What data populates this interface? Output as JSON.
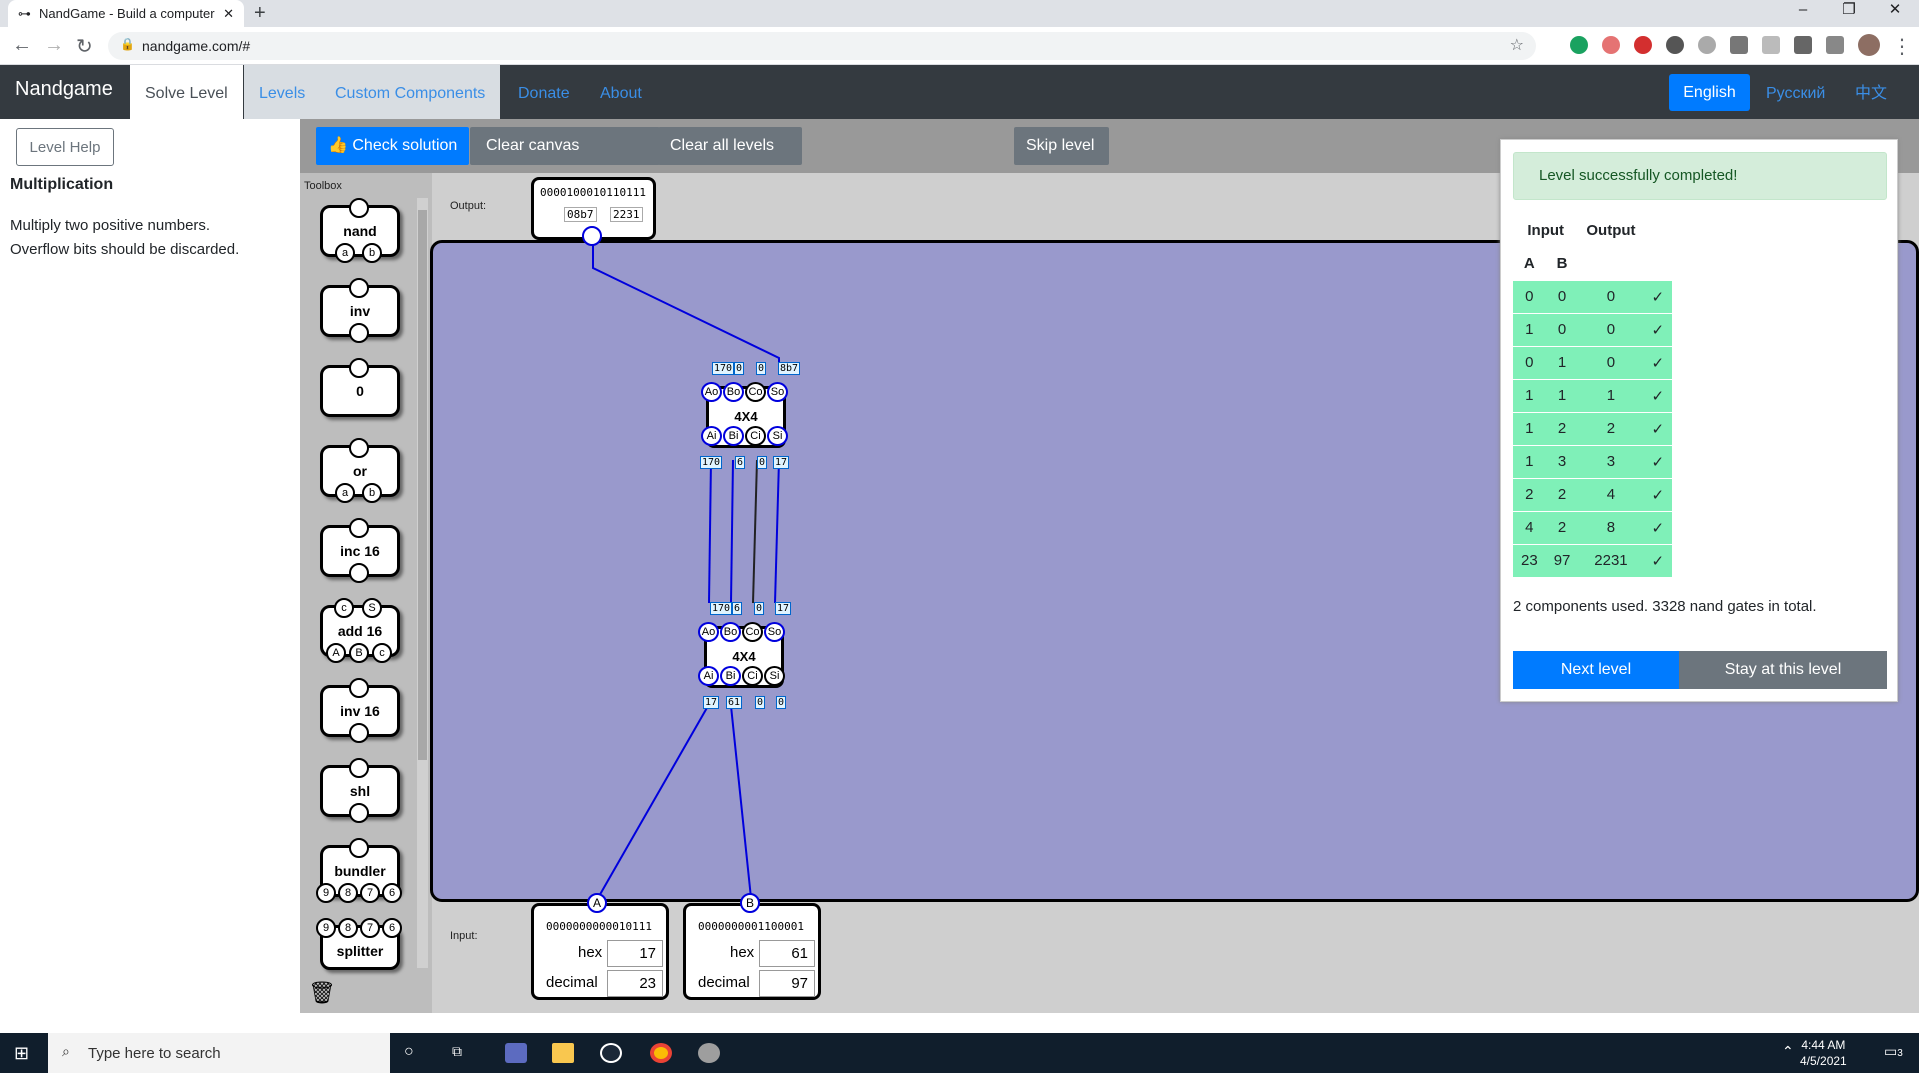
{
  "browser": {
    "tab_title": "NandGame - Build a computer fr",
    "url": "nandgame.com/#"
  },
  "nav": {
    "brand": "Nandgame",
    "links": [
      "Solve Level",
      "Levels",
      "Custom Components",
      "Donate",
      "About"
    ],
    "languages": [
      "English",
      "Русский",
      "中文"
    ]
  },
  "level": {
    "help_button": "Level Help",
    "title": "Multiplication",
    "description_line1": "Multiply two positive numbers.",
    "description_line2": "Overflow bits should be discarded."
  },
  "toolbar": {
    "check": "Check solution",
    "clear_canvas": "Clear canvas",
    "clear_all": "Clear all levels",
    "skip": "Skip level"
  },
  "toolbox": {
    "label": "Toolbox",
    "items": [
      "nand",
      "inv",
      "0",
      "or",
      "inc 16",
      "add 16",
      "inv 16",
      "shl",
      "bundler",
      "splitter"
    ]
  },
  "canvas": {
    "output_label": "Output:",
    "input_label": "Input:",
    "output_bits": "0000100010110111",
    "output_hex": "08b7",
    "output_dec": "2231",
    "input_a_bits": "0000000000010111",
    "input_a_hex": "17",
    "input_a_dec": "23",
    "input_b_bits": "0000000001100001",
    "input_b_hex": "61",
    "input_b_dec": "97",
    "hex_label": "hex",
    "decimal_label": "decimal",
    "pin_a": "A",
    "pin_b": "B",
    "comp_name": "4X4",
    "top_comp": {
      "ao": "170",
      "bo": "0",
      "co": "0",
      "so": "8b7",
      "ai": "170",
      "bi": "6",
      "ci": "0",
      "si": "17"
    },
    "bottom_comp": {
      "ao": "170",
      "bo": "6",
      "co": "0",
      "so": "17",
      "ai": "17",
      "bi": "61",
      "ci": "0",
      "si": "0"
    }
  },
  "result": {
    "message": "Level successfully completed!",
    "header_input": "Input",
    "header_output": "Output",
    "col_a": "A",
    "col_b": "B",
    "rows": [
      [
        "0",
        "0",
        "0"
      ],
      [
        "1",
        "0",
        "0"
      ],
      [
        "0",
        "1",
        "0"
      ],
      [
        "1",
        "1",
        "1"
      ],
      [
        "1",
        "2",
        "2"
      ],
      [
        "1",
        "3",
        "3"
      ],
      [
        "2",
        "2",
        "4"
      ],
      [
        "4",
        "2",
        "8"
      ],
      [
        "23",
        "97",
        "2231"
      ]
    ],
    "check_mark": "✓",
    "usage": "2 components used. 3328 nand gates in total.",
    "next": "Next level",
    "stay": "Stay at this level"
  },
  "taskbar": {
    "search": "Type here to search",
    "time": "4:44 AM",
    "date": "4/5/2021",
    "notif_count": "3"
  },
  "colors": {
    "primary": "#007bff",
    "board": "#9999cc",
    "wire": "#0000dd",
    "success_row": "#7ff0b8"
  }
}
